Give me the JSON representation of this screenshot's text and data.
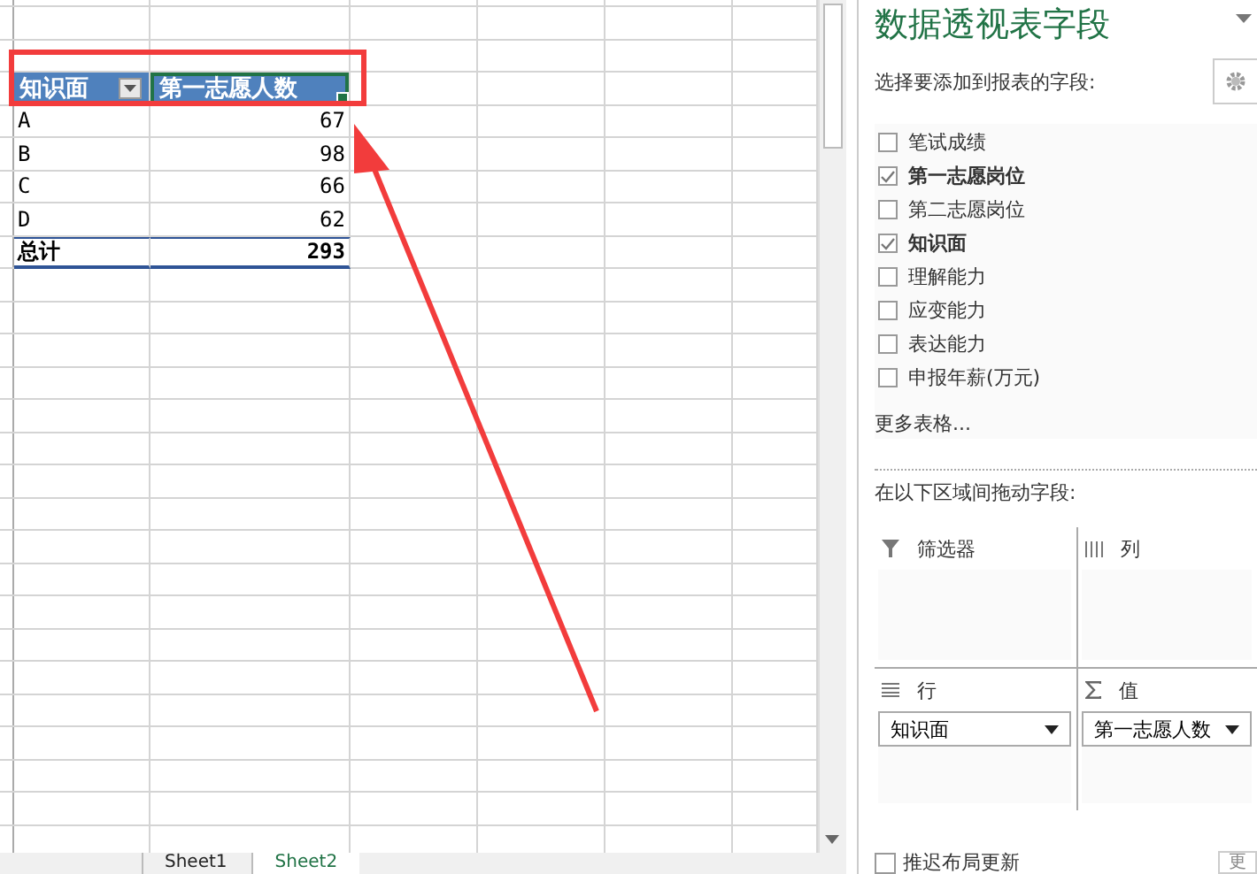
{
  "pivot": {
    "header_cells": [
      {
        "text": "知识面",
        "selected": false
      },
      {
        "text": "第一志愿人数",
        "selected": true
      }
    ],
    "rows": [
      {
        "label": "A",
        "value": "67"
      },
      {
        "label": "B",
        "value": "98"
      },
      {
        "label": "C",
        "value": "66"
      },
      {
        "label": "D",
        "value": "62"
      }
    ],
    "total": {
      "label": "总计",
      "value": "293"
    }
  },
  "sheet_tabs": [
    {
      "label": "Sheet1",
      "selected": false
    },
    {
      "label": "Sheet2",
      "selected": true
    }
  ],
  "field_panel": {
    "title": "数据透视表字段",
    "caption": "选择要添加到报表的字段:",
    "fields": [
      {
        "label": "笔试成绩",
        "checked": false
      },
      {
        "label": "第一志愿岗位",
        "checked": true
      },
      {
        "label": "第二志愿岗位",
        "checked": false
      },
      {
        "label": "知识面",
        "checked": true
      },
      {
        "label": "理解能力",
        "checked": false
      },
      {
        "label": "应变能力",
        "checked": false
      },
      {
        "label": "表达能力",
        "checked": false
      },
      {
        "label": "申报年薪(万元)",
        "checked": false
      }
    ],
    "more_tables": "更多表格...",
    "areas_caption": "在以下区域间拖动字段:",
    "areas": [
      {
        "kind": "filter",
        "label": "筛选器"
      },
      {
        "kind": "columns",
        "label": "列"
      },
      {
        "kind": "rows",
        "label": "行",
        "items": [
          "知识面"
        ]
      },
      {
        "kind": "values",
        "label": "值",
        "items": [
          "第一志愿人数"
        ]
      }
    ],
    "defer_update": {
      "label": "推迟布局更新",
      "checked": false
    },
    "update_button": "更"
  }
}
